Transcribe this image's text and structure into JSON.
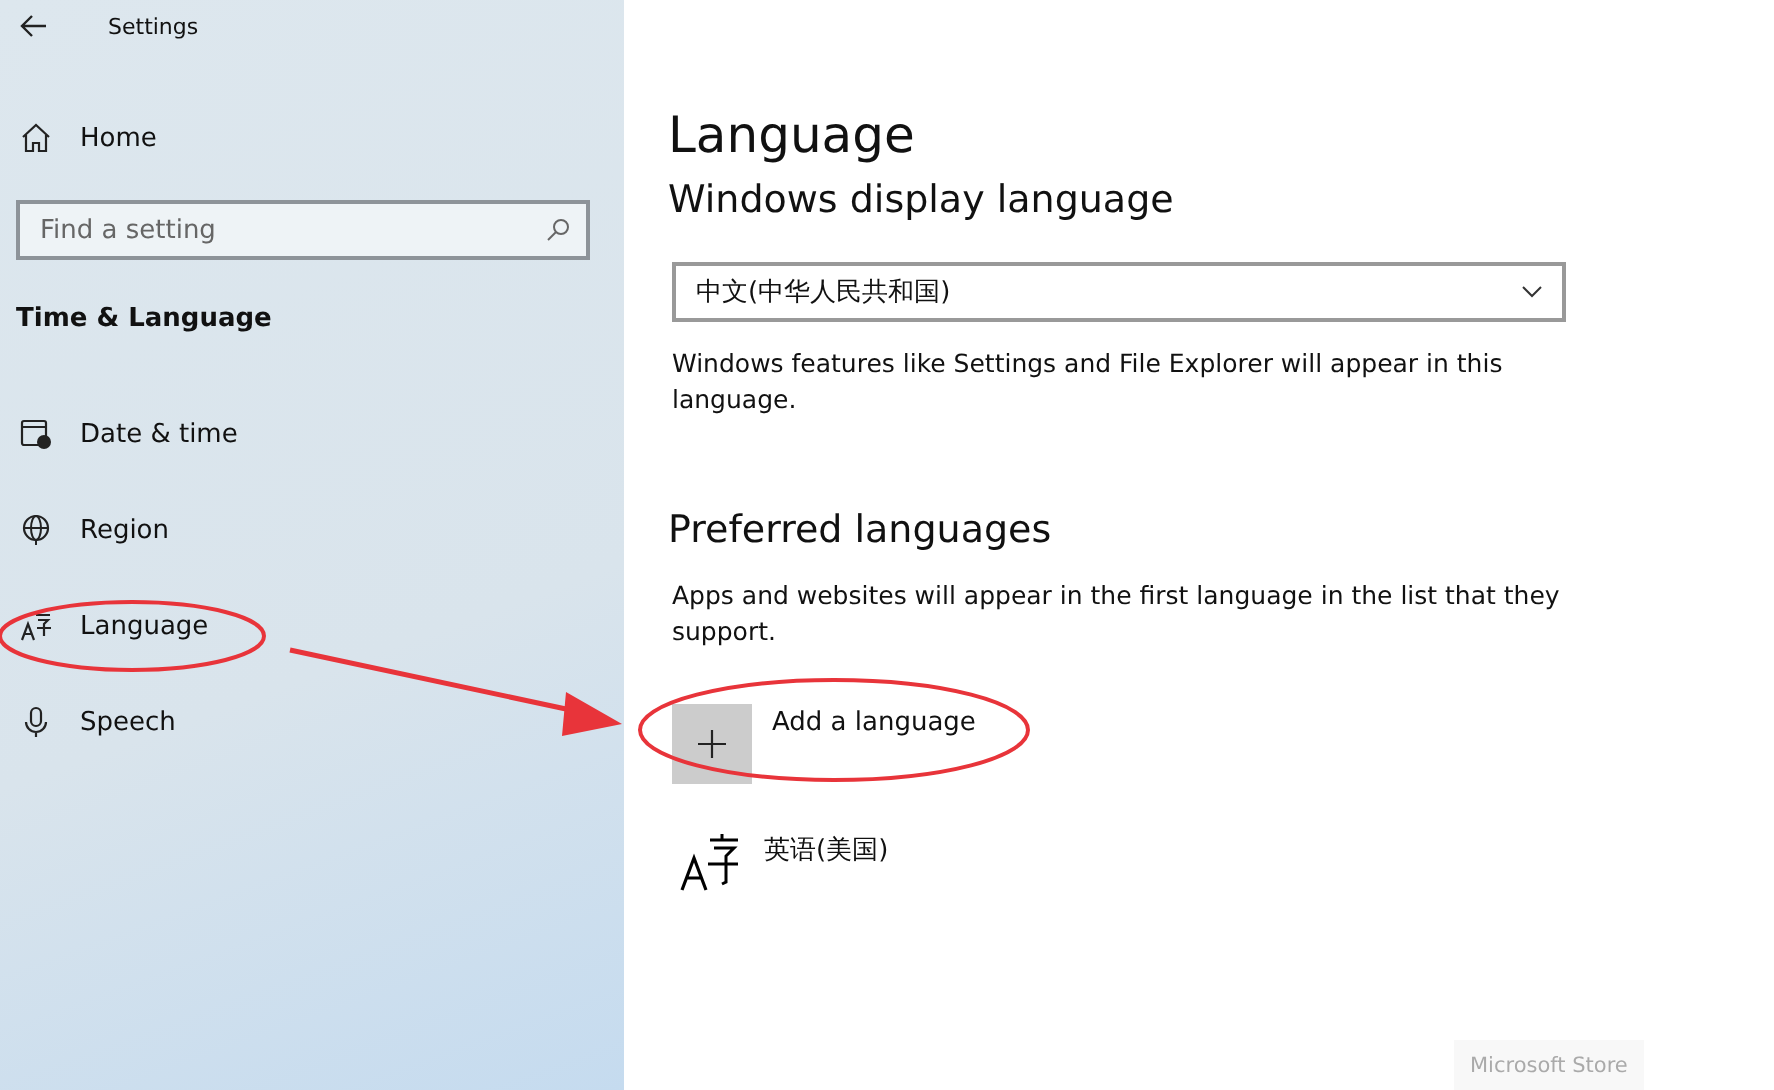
{
  "window": {
    "title": "Settings"
  },
  "sidebar": {
    "home": "Home",
    "search": {
      "placeholder": "Find a setting"
    },
    "section": "Time & Language",
    "items": [
      {
        "label": "Date & time"
      },
      {
        "label": "Region"
      },
      {
        "label": "Language"
      },
      {
        "label": "Speech"
      }
    ]
  },
  "page": {
    "title": "Language",
    "display_language": {
      "heading": "Windows display language",
      "value": "中文(中华人民共和国)",
      "description": "Windows features like Settings and File Explorer will appear in this language."
    },
    "preferred": {
      "heading": "Preferred languages",
      "description": "Apps and websites will appear in the first language in the list that they support.",
      "add_button": "Add a language",
      "languages": [
        {
          "name": "英语(美国)"
        }
      ]
    },
    "store_button": {
      "label": "Microsoft Store",
      "disabled": true
    }
  }
}
